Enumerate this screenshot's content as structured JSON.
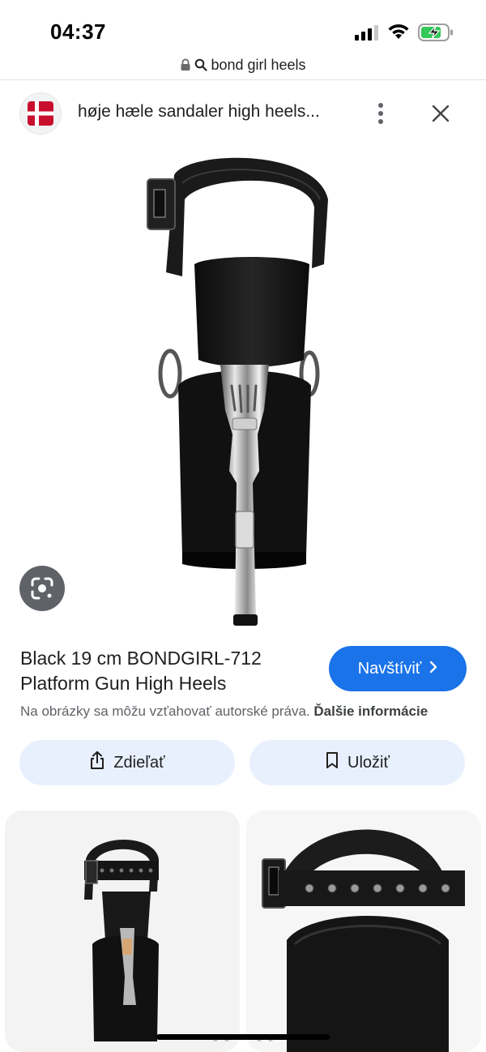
{
  "status_bar": {
    "time": "04:37",
    "icons": [
      "cellular-signal-icon",
      "wifi-icon",
      "battery-charging-icon"
    ],
    "battery_color": "#34c759"
  },
  "url_bar": {
    "text": "bond girl heels",
    "icons": [
      "lock-icon",
      "search-icon"
    ]
  },
  "source": {
    "title": "høje hæle sandaler high heels...",
    "favicon": "danish-flag-icon",
    "menu_icon": "more-vert-icon",
    "close_icon": "close-icon"
  },
  "main_image": {
    "description_icon": "lens-search-icon"
  },
  "product": {
    "title": "Black 19 cm BONDGIRL-712 Platform Gun High Heels",
    "visit_label": "Navštíviť",
    "copyright_text": "Na obrázky sa môžu vzťahovať autorské práva.",
    "more_info_label": "Ďalšie informácie"
  },
  "actions": {
    "share_label": "Zdieľať",
    "save_label": "Uložiť"
  },
  "colors": {
    "accent": "#1a73e8",
    "action_bg": "#e8f0fe",
    "secondary_text": "#5f6368",
    "flag_red": "#c8102e"
  }
}
